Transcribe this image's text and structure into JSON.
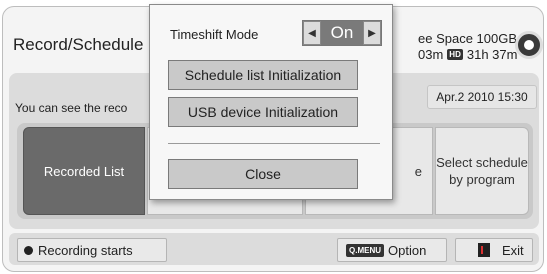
{
  "header": {
    "title": "Record/Schedule",
    "free_space": "ee Space 100GB",
    "time_sd": "03m",
    "hd_badge": "HD",
    "time_hd": "31h 37m"
  },
  "content": {
    "description": "You can see the reco",
    "datetime": "Apr.2 2010 15:30",
    "options": {
      "recorded_list": "Recorded List",
      "hidden_partial": "e",
      "select_schedule": "Select schedule by program"
    }
  },
  "bottom_bar": {
    "record_label": "Recording starts",
    "qmenu_badge": "Q.MENU",
    "option_label": "Option",
    "exit_label": "Exit"
  },
  "popup": {
    "timeshift_label": "Timeshift Mode",
    "timeshift_value": "On",
    "schedule_init": "Schedule list Initialization",
    "usb_init": "USB device Initialization",
    "close": "Close"
  },
  "icons": {
    "left_arrow": "left-arrow-icon",
    "right_arrow": "right-arrow-icon",
    "record_dot": "record-dot-icon",
    "disc": "disc-usage-icon",
    "exit": "exit-icon"
  }
}
